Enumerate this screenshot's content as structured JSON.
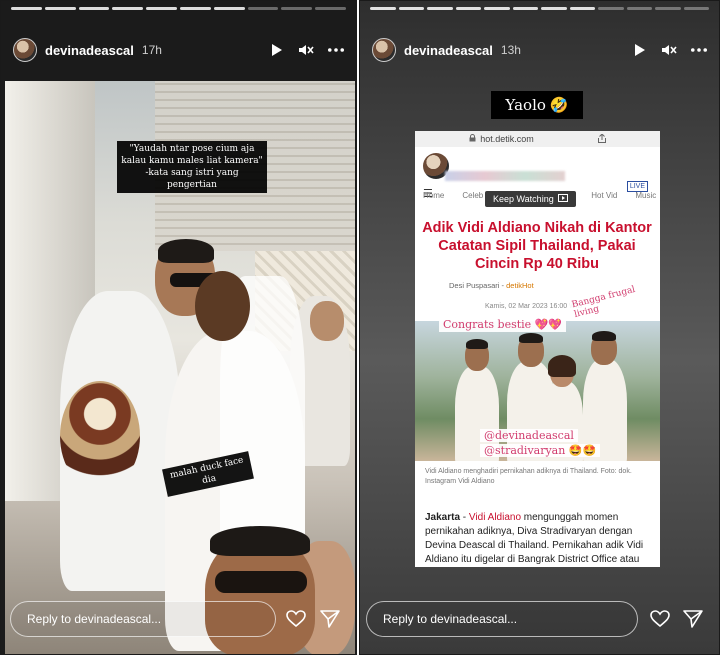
{
  "left_story": {
    "username": "devinadeascal",
    "timestamp": "17h",
    "caption_quote": "\"Yaudah ntar pose cium aja kalau kamu males liat kamera\" -kata sang istri yang pengertian",
    "caption_duck": "malah duck face dia",
    "reply_placeholder": "Reply to devinadeascal..."
  },
  "right_story": {
    "username": "devinadeascal",
    "timestamp": "13h",
    "yaolo_text": "Yaolo",
    "yaolo_emoji": "🤣",
    "url": "hot.detik.com",
    "keep_watching": "Keep Watching",
    "nav_menu": "☰",
    "live_badge": "LIVE",
    "tabs": [
      "Home",
      "Celeb",
      "Hot Vid",
      "Music"
    ],
    "headline": "Adik Vidi Aldiano Nikah di Kantor Catatan Sipil Thailand, Pakai Cincin Rp 40 Ribu",
    "author": "Desi Puspasari",
    "source": "detikHot",
    "date": "Kamis, 02 Mar 2023 16:00 WIB",
    "sticker_frugal": "Bangga frugal living",
    "sticker_congrats": "Congrats bestie 💖💖",
    "mention_1": "@devinadeascal",
    "mention_2": "@stradivaryan 🤩🤩",
    "photo_caption": "Vidi Aldiano menghadiri pernikahan adiknya di Thailand. Foto: dok. Instagram Vidi Aldiano",
    "body_lead": "Jakarta",
    "body_dash": " - ",
    "body_link": "Vidi Aldiano",
    "body_rest": " mengunggah momen pernikahan adiknya, Diva Stradivaryan dengan Devina Deascal di Thailand. Pernikahan adik Vidi Aldiano itu digelar di Bangrak District Office atau",
    "reply_placeholder": "Reply to devinadeascal..."
  },
  "icons": {
    "play": "▶",
    "mute": "🔇",
    "more": "•••",
    "heart": "♡",
    "send": "➢",
    "lock": "🔒",
    "share": "⇪"
  },
  "colors": {
    "headline_red": "#c8102e",
    "sticker_pink": "#d13b6d"
  }
}
